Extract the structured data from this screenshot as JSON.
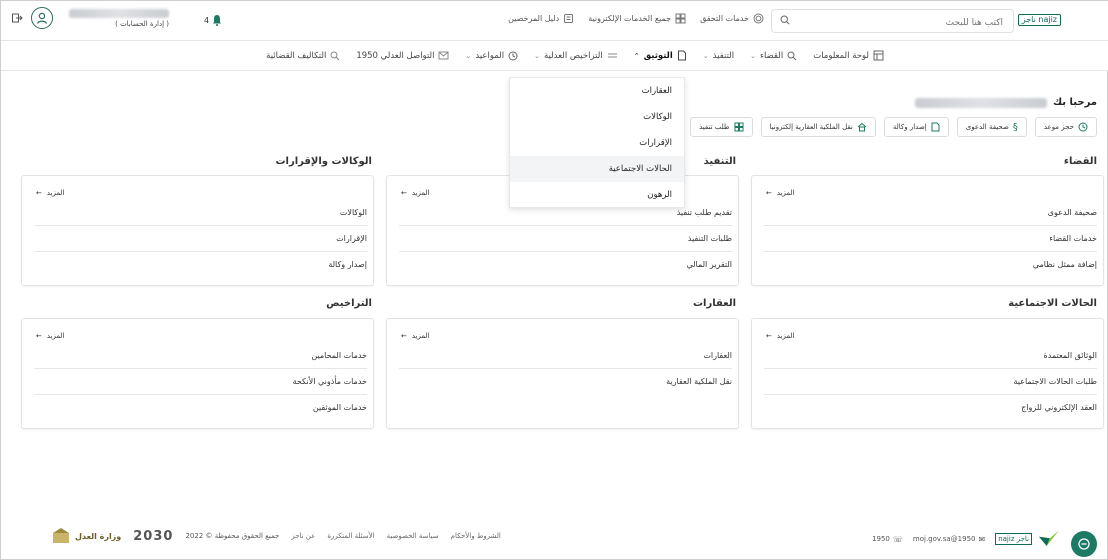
{
  "brand": {
    "logo_text": "ناجز najiz"
  },
  "header": {
    "search_placeholder": "اكتب هنا للبحث",
    "links": [
      {
        "label": "خدمات التحقق",
        "icon": "fingerprint-icon"
      },
      {
        "label": "جميع الخدمات الإلكترونية",
        "icon": "grid-icon"
      },
      {
        "label": "دليل المرخصين",
        "icon": "badge-icon"
      }
    ],
    "user_role": "( إدارة الحسابات )",
    "notifications_count": "4"
  },
  "nav": {
    "items": [
      {
        "label": "لوحة المعلومات",
        "icon": "dashboard-icon",
        "active": false
      },
      {
        "label": "القضاء",
        "icon": "search-icon",
        "active": false
      },
      {
        "label": "التنفيذ",
        "icon": "",
        "active": false
      },
      {
        "label": "التوثيق",
        "icon": "document-icon",
        "active": true
      },
      {
        "label": "التراخيص العدلية",
        "icon": "license-icon",
        "active": false
      },
      {
        "label": "المواعيد",
        "icon": "clock-icon",
        "active": false
      },
      {
        "label": "التواصل العدلي 1950",
        "icon": "mail-icon",
        "active": false
      },
      {
        "label": "التكاليف القضائية",
        "icon": "search-icon",
        "active": false
      }
    ],
    "dropdown": [
      "العقارات",
      "الوكالات",
      "الإقرارات",
      "الحالات الاجتماعية",
      "الرهون"
    ],
    "dropdown_hover_index": 3
  },
  "welcome": {
    "greeting": "مرحبا بك"
  },
  "quick_actions": [
    {
      "label": "حجز موعد",
      "icon": "clock-icon"
    },
    {
      "label": "صحيفة الدعوى",
      "icon": "section-icon"
    },
    {
      "label": "إصدار وكالة",
      "icon": "document-icon"
    },
    {
      "label": "نقل الملكية العقارية إلكترونيا",
      "icon": "home-icon"
    },
    {
      "label": "طلب تنفيذ",
      "icon": "grid-icon"
    }
  ],
  "more_label": "المزيد",
  "sections": [
    {
      "title": "القضاء",
      "items": [
        "صحيفة الدعوى",
        "خدمات القضاء",
        "إضافة ممثل نظامي"
      ]
    },
    {
      "title": "التنفيذ",
      "items": [
        "تقديم طلب تنفيذ",
        "طلبات التنفيذ",
        "التقرير المالي"
      ]
    },
    {
      "title": "الوكالات والإقرارات",
      "items": [
        "الوكالات",
        "الإقرارات",
        "إصدار وكالة"
      ]
    },
    {
      "title": "الحالات الاجتماعية",
      "items": [
        "الوثائق المعتمدة",
        "طلبات الحالات الاجتماعية",
        "العقد الإلكتروني للزواج"
      ]
    },
    {
      "title": "العقارات",
      "items": [
        "العقارات",
        "نقل الملكية العقارية"
      ]
    },
    {
      "title": "التراخيص",
      "items": [
        "خدمات المحامين",
        "خدمات مأذوني الأنكحة",
        "خدمات الموثقين"
      ]
    }
  ],
  "footer": {
    "links": [
      "عن ناجز",
      "الأسئلة المتكررة",
      "سياسة الخصوصية",
      "الشروط والأحكام"
    ],
    "copyright": "جميع الحقوق محفوظة © 2022",
    "vision": "2030",
    "ministry": "وزارة العدل",
    "phone": "1950",
    "email": "1950@moj.gov.sa"
  },
  "colors": {
    "brand_green": "#0d6b5a",
    "brand_accent": "#8bc53f",
    "chat_bg": "#1d7a63"
  }
}
